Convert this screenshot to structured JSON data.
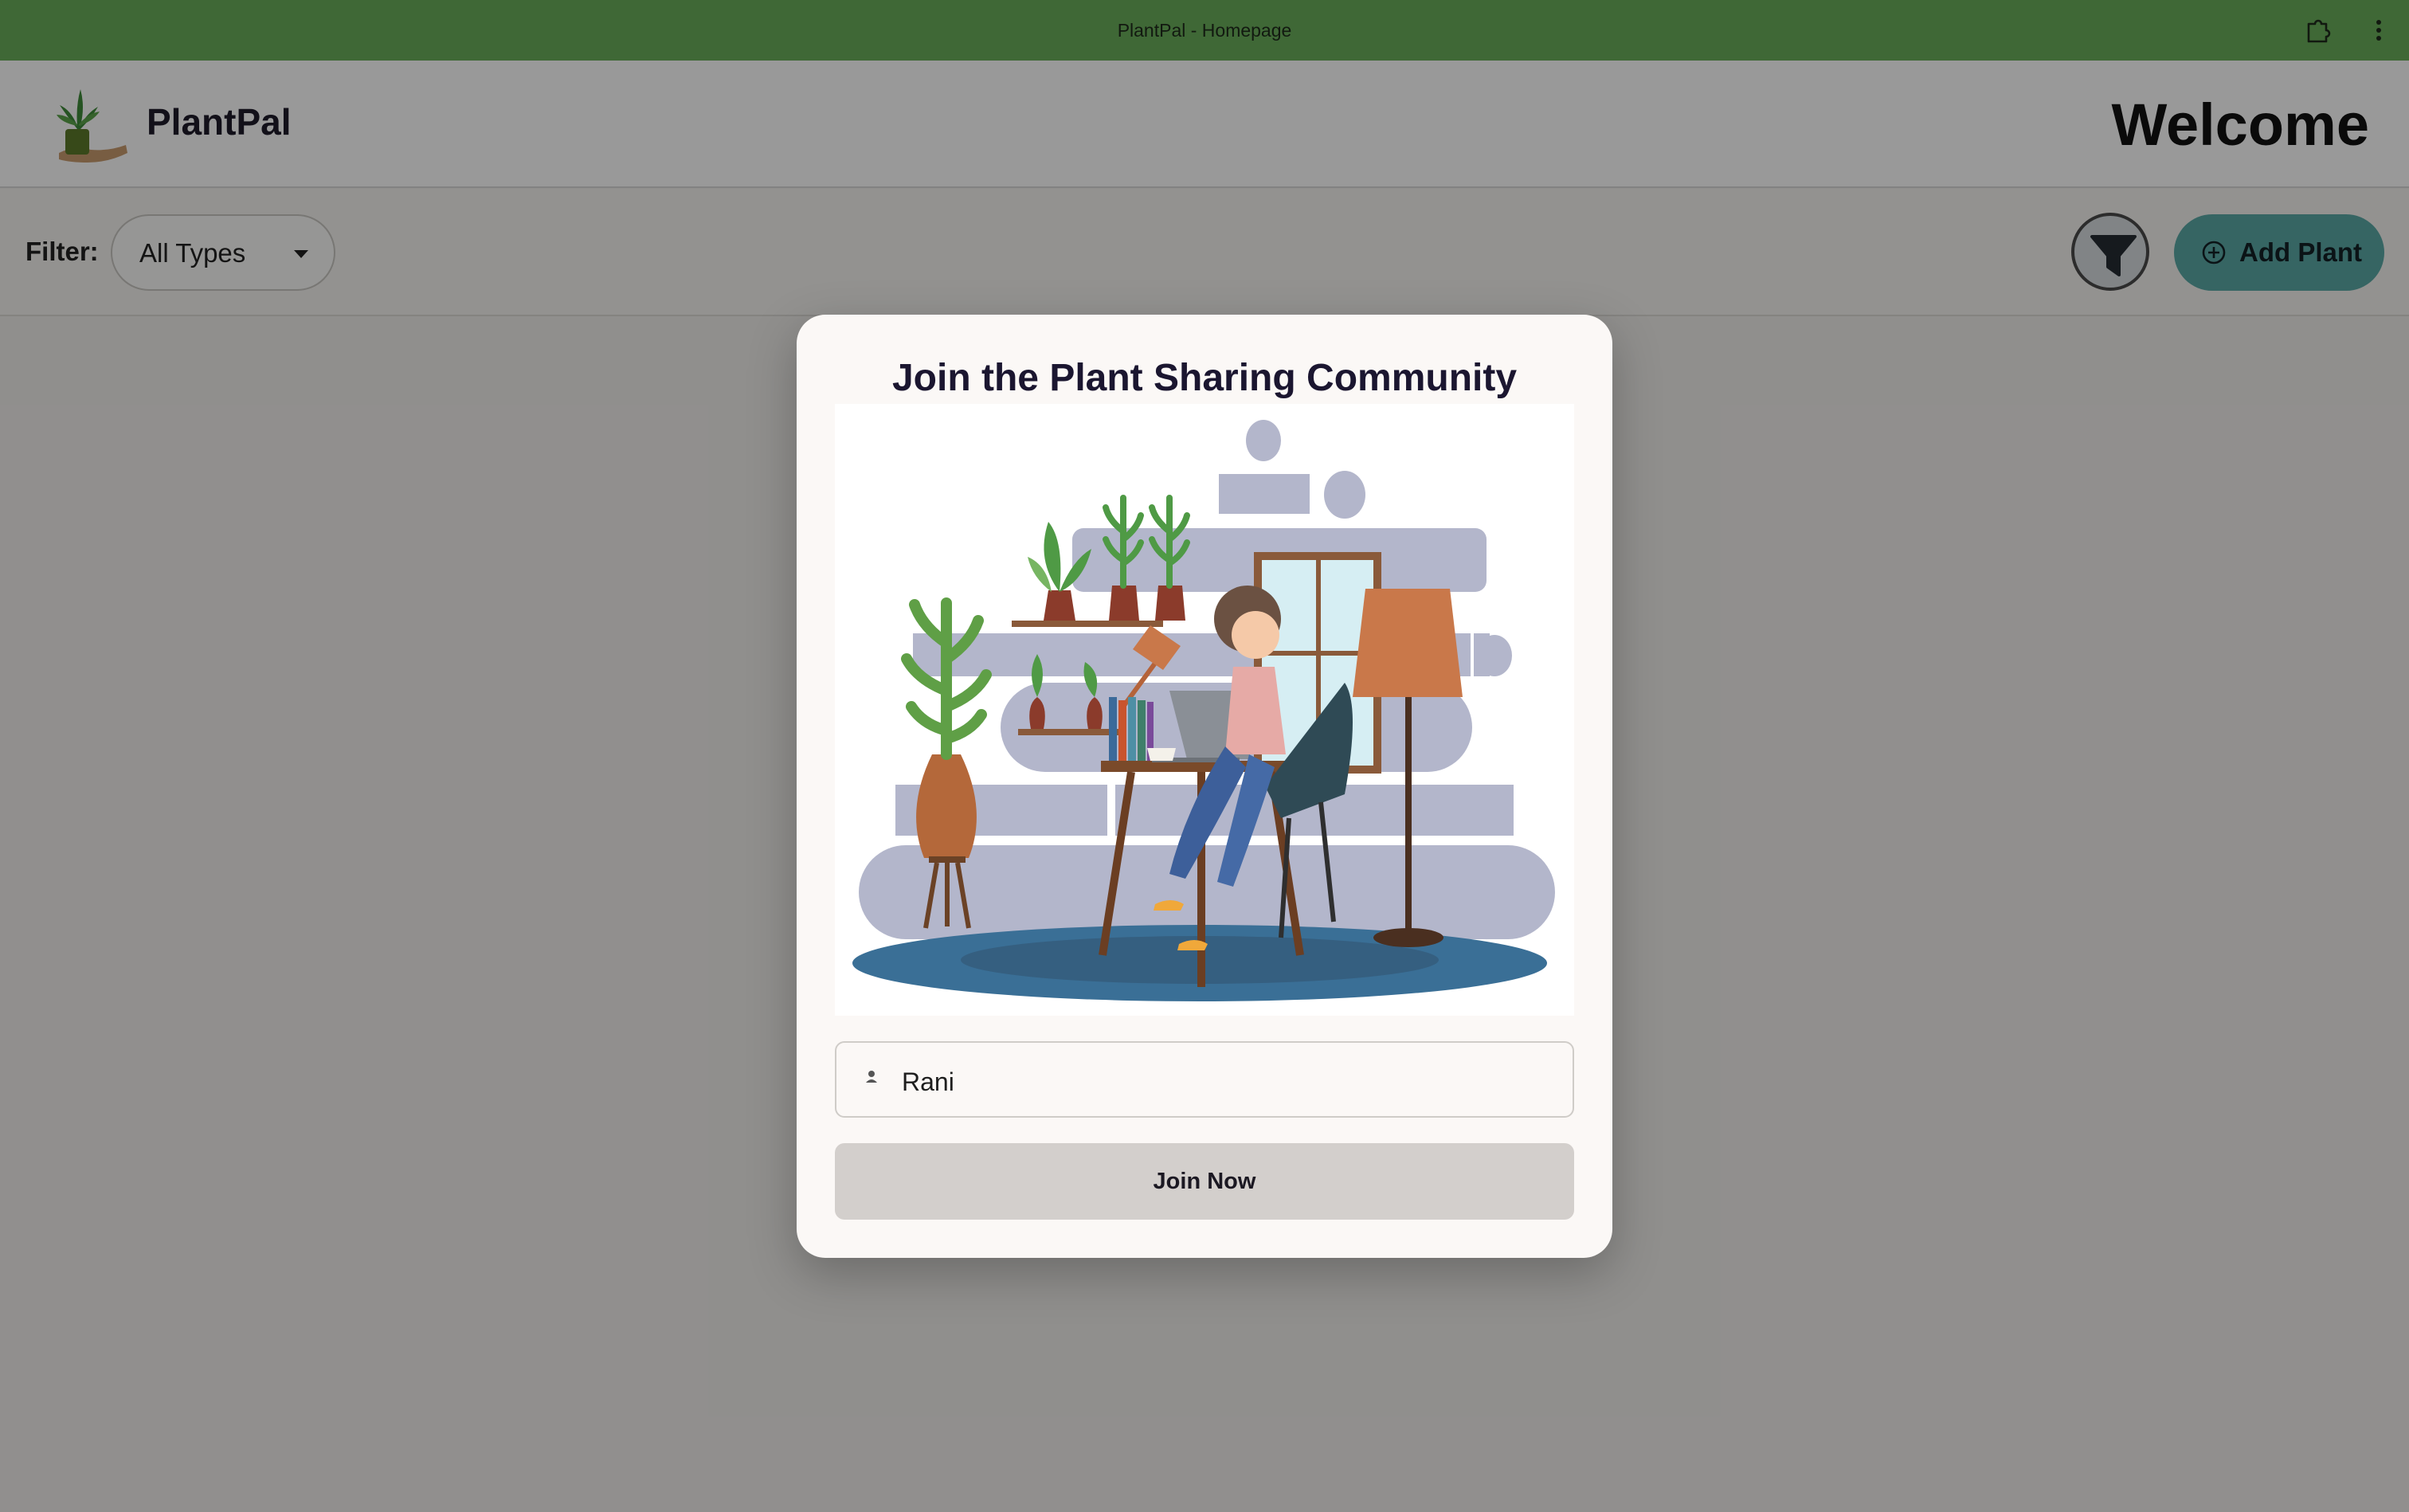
{
  "browser": {
    "title": "PlantPal - Homepage",
    "extensions_icon": "puzzle-icon",
    "menu_icon": "kebab-menu-icon"
  },
  "header": {
    "logo_icon": "potted-plant-logo",
    "brand": "PlantPal",
    "greeting": "Welcome"
  },
  "filter_bar": {
    "label": "Filter:",
    "selected_type": "All Types",
    "filter_icon": "funnel-icon",
    "add_button_label": "Add Plant",
    "add_button_icon": "plus-circle-icon"
  },
  "modal": {
    "title": "Join the Plant Sharing Community",
    "illustration": "woman-at-desk-with-plants-illustration",
    "name_input_icon": "user-icon",
    "name_value": "Rani",
    "join_button_label": "Join Now"
  },
  "colors": {
    "titlebar": "#69ad5a",
    "accent": "#5aa8a6",
    "join_button": "#d3cfcc",
    "modal_bg": "#fbf8f6"
  }
}
